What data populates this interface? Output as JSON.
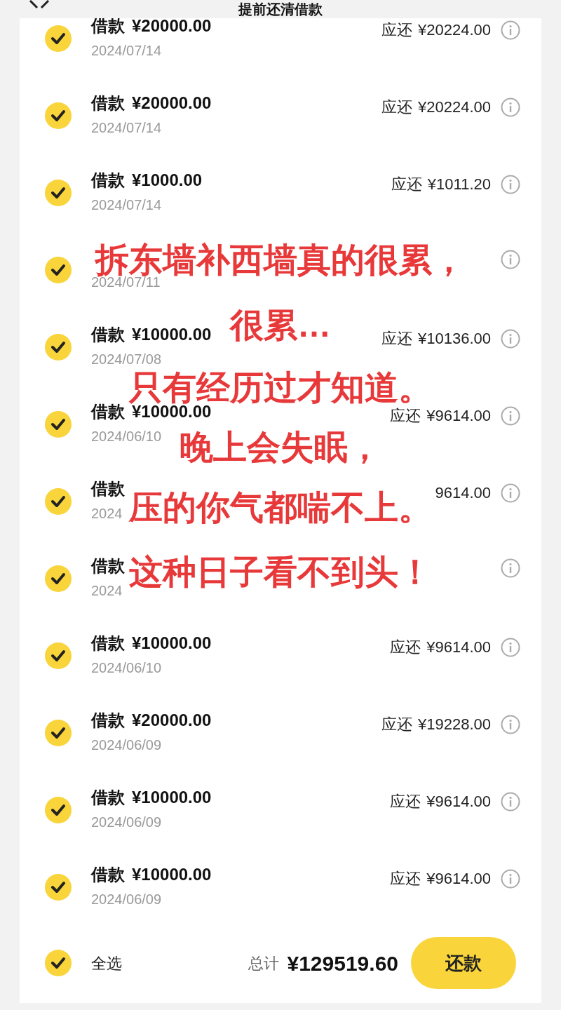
{
  "header": {
    "title": "提前还清借款"
  },
  "loans": [
    {
      "checked": true,
      "loan_label": "借款",
      "loan_amount": "¥20000.00",
      "date": "2024/07/14",
      "due_label": "应还",
      "due_amount": "¥20224.00"
    },
    {
      "checked": true,
      "loan_label": "借款",
      "loan_amount": "¥20000.00",
      "date": "2024/07/14",
      "due_label": "应还",
      "due_amount": "¥20224.00"
    },
    {
      "checked": true,
      "loan_label": "借款",
      "loan_amount": "¥1000.00",
      "date": "2024/07/14",
      "due_label": "应还",
      "due_amount": "¥1011.20"
    },
    {
      "checked": true,
      "date": "2024/07/11"
    },
    {
      "checked": true,
      "loan_label": "借款",
      "loan_amount": "¥10000.00",
      "date": "2024/07/08",
      "due_label": "应还",
      "due_amount": "¥10136.00"
    },
    {
      "checked": true,
      "loan_label": "借款",
      "loan_amount": "¥10000.00",
      "date": "2024/06/10",
      "due_label": "应还",
      "due_amount": "¥9614.00"
    },
    {
      "checked": true,
      "loan_label": "借款",
      "date": "2024",
      "due_amount": "9614.00"
    },
    {
      "checked": true,
      "loan_label": "借款",
      "date": "2024"
    },
    {
      "checked": true,
      "loan_label": "借款",
      "loan_amount": "¥10000.00",
      "date": "2024/06/10",
      "due_label": "应还",
      "due_amount": "¥9614.00"
    },
    {
      "checked": true,
      "loan_label": "借款",
      "loan_amount": "¥20000.00",
      "date": "2024/06/09",
      "due_label": "应还",
      "due_amount": "¥19228.00"
    },
    {
      "checked": true,
      "loan_label": "借款",
      "loan_amount": "¥10000.00",
      "date": "2024/06/09",
      "due_label": "应还",
      "due_amount": "¥9614.00"
    },
    {
      "checked": true,
      "loan_label": "借款",
      "loan_amount": "¥10000.00",
      "date": "2024/06/09",
      "due_label": "应还",
      "due_amount": "¥9614.00"
    }
  ],
  "footer": {
    "select_all": {
      "label": "全选",
      "checked": true
    },
    "total_label": "总计",
    "total": "¥129519.60",
    "pay_button": "还款"
  },
  "caption": [
    "拆东墙补西墙真的很累，",
    "很累…",
    "只有经历过才知道。",
    "晚上会失眠，",
    "压的你气都喘不上。",
    "这种日子看不到头！"
  ]
}
